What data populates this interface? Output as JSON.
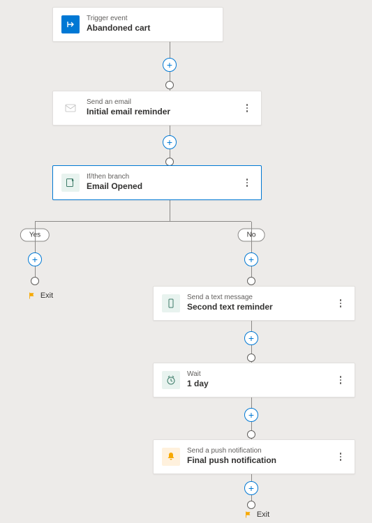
{
  "chart_data": {
    "type": "flowchart",
    "trigger": {
      "type_label": "Trigger event",
      "title": "Abandoned cart"
    },
    "steps": [
      {
        "id": "email1",
        "type_label": "Send an email",
        "title": "Initial email reminder"
      },
      {
        "id": "branch",
        "type_label": "If/then branch",
        "title": "Email Opened",
        "selected": true,
        "branches": {
          "yes": {
            "label": "Yes",
            "steps": [],
            "exit_label": "Exit"
          },
          "no": {
            "label": "No",
            "steps": [
              {
                "id": "sms",
                "type_label": "Send a text message",
                "title": "Second text reminder"
              },
              {
                "id": "wait",
                "type_label": "Wait",
                "title": "1 day"
              },
              {
                "id": "push",
                "type_label": "Send a push notification",
                "title": "Final push notification"
              }
            ],
            "exit_label": "Exit"
          }
        }
      }
    ]
  },
  "ui": {
    "trigger_type": "Trigger event",
    "trigger_title": "Abandoned cart",
    "email_type": "Send an email",
    "email_title": "Initial email reminder",
    "branch_type": "If/then branch",
    "branch_title": "Email Opened",
    "yes": "Yes",
    "no": "No",
    "exit": "Exit",
    "sms_type": "Send a text message",
    "sms_title": "Second text reminder",
    "wait_type": "Wait",
    "wait_title": "1 day",
    "push_type": "Send a push notification",
    "push_title": "Final push notification"
  }
}
